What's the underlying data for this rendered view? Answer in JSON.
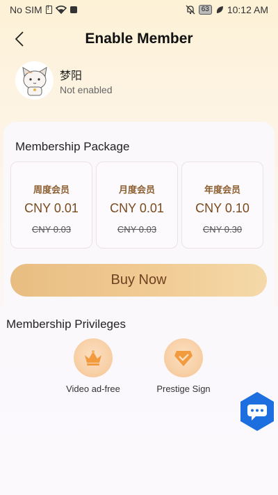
{
  "status_bar": {
    "carrier": "No SIM",
    "battery": "63",
    "time": "10:12 AM"
  },
  "header": {
    "title": "Enable Member"
  },
  "profile": {
    "name": "梦阳",
    "status": "Not enabled"
  },
  "package": {
    "title": "Membership Package",
    "plans": [
      {
        "name": "周度会员",
        "price": "CNY 0.01",
        "original": "CNY 0.03"
      },
      {
        "name": "月度会员",
        "price": "CNY 0.01",
        "original": "CNY 0.03"
      },
      {
        "name": "年度会员",
        "price": "CNY 0.10",
        "original": "CNY 0.30"
      }
    ],
    "buy_label": "Buy Now"
  },
  "privileges": {
    "title": "Membership Privileges",
    "items": [
      {
        "label": "Video ad-free",
        "icon": "crown-icon"
      },
      {
        "label": "Prestige Sign",
        "icon": "gem-badge-icon"
      }
    ]
  },
  "colors": {
    "accent_gold": "#e8bd82",
    "price_brown": "#7a4a1e",
    "chat_blue": "#1d6fe0"
  }
}
